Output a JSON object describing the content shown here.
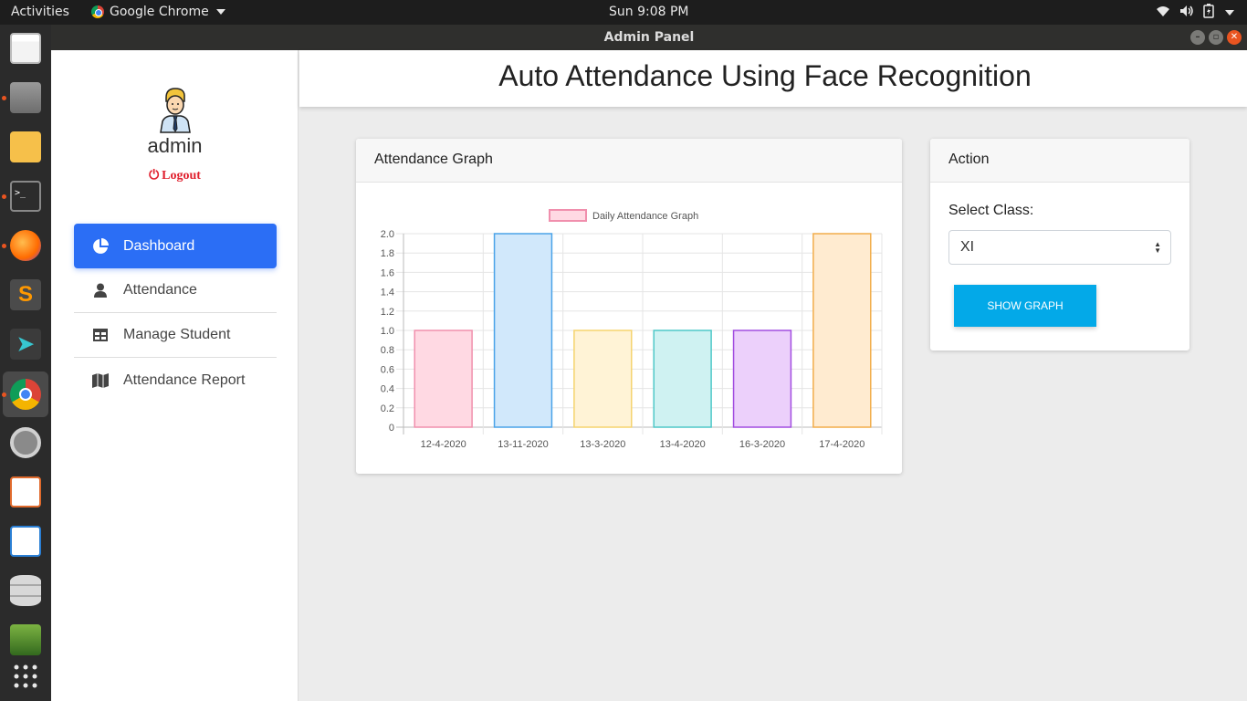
{
  "topbar": {
    "activities": "Activities",
    "app_name": "Google Chrome",
    "clock": "Sun  9:08 PM"
  },
  "window": {
    "title": "Admin Panel"
  },
  "sidebar": {
    "username": "admin",
    "logout": "Logout",
    "items": [
      {
        "label": "Dashboard",
        "icon": "pie-chart-icon",
        "active": true
      },
      {
        "label": "Attendance",
        "icon": "user-icon",
        "active": false
      },
      {
        "label": "Manage Student",
        "icon": "table-icon",
        "active": false
      },
      {
        "label": "Attendance Report",
        "icon": "map-icon",
        "active": false
      }
    ]
  },
  "header": {
    "title": "Auto Attendance Using Face Recognition"
  },
  "graph_card": {
    "title": "Attendance Graph"
  },
  "action_card": {
    "title": "Action",
    "select_label": "Select Class:",
    "select_value": "XI",
    "button_label": "SHOW GRAPH"
  },
  "chart_data": {
    "type": "bar",
    "categories": [
      "12-4-2020",
      "13-11-2020",
      "13-3-2020",
      "13-4-2020",
      "16-3-2020",
      "17-4-2020"
    ],
    "series": [
      {
        "name": "Daily Attendance Graph",
        "values": [
          1,
          2,
          1,
          1,
          1,
          2
        ]
      }
    ],
    "ylim": [
      0,
      2.0
    ],
    "yticks": [
      "0",
      "0.2",
      "0.4",
      "0.6",
      "0.8",
      "1.0",
      "1.2",
      "1.4",
      "1.6",
      "1.8",
      "2.0"
    ],
    "grid": true,
    "legend": "top-center",
    "fills": [
      "#ffd9e3",
      "#d1e8fb",
      "#fff3d6",
      "#cff2f2",
      "#ecd0fb",
      "#ffebd0"
    ],
    "strokes": [
      "#f08fad",
      "#4aa3e8",
      "#f5d46e",
      "#4fc8c8",
      "#a24de0",
      "#f2ad4a"
    ]
  }
}
